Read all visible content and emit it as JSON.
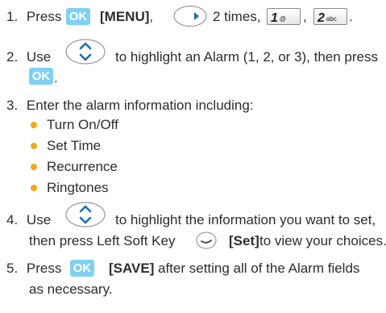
{
  "steps": [
    {
      "num": "1.",
      "parts": [
        "Press",
        "[MENU]",
        ",",
        "2 times,",
        ",",
        "."
      ]
    },
    {
      "num": "2.",
      "line1_a": "Use",
      "line1_b": "to highlight an Alarm (1, 2, or 3), then press",
      "line2": "."
    },
    {
      "num": "3.",
      "text": "Enter the alarm information including:"
    },
    {
      "num": "4.",
      "line1_a": "Use",
      "line1_b": "to highlight the information you want to set,",
      "line2_a": "then press Left Soft Key",
      "line2_b": "[Set]",
      "line2_c": "to view your choices."
    },
    {
      "num": "5.",
      "line1_a": "Press",
      "line1_b": "[SAVE]",
      "line1_c": "after setting all of the Alarm fields",
      "line2": "as necessary."
    }
  ],
  "bullets": [
    "Turn On/Off",
    "Set Time",
    "Recurrence",
    "Ringtones"
  ],
  "keys": {
    "ok_label": "OK",
    "key1_digit": "1",
    "key1_sub": "@",
    "key2_digit": "2",
    "key2_sub": "abc"
  },
  "colors": {
    "ok_key": "#7fd0f2",
    "bullet": "#f0a81c",
    "nav_key": "#1d6fb8"
  }
}
